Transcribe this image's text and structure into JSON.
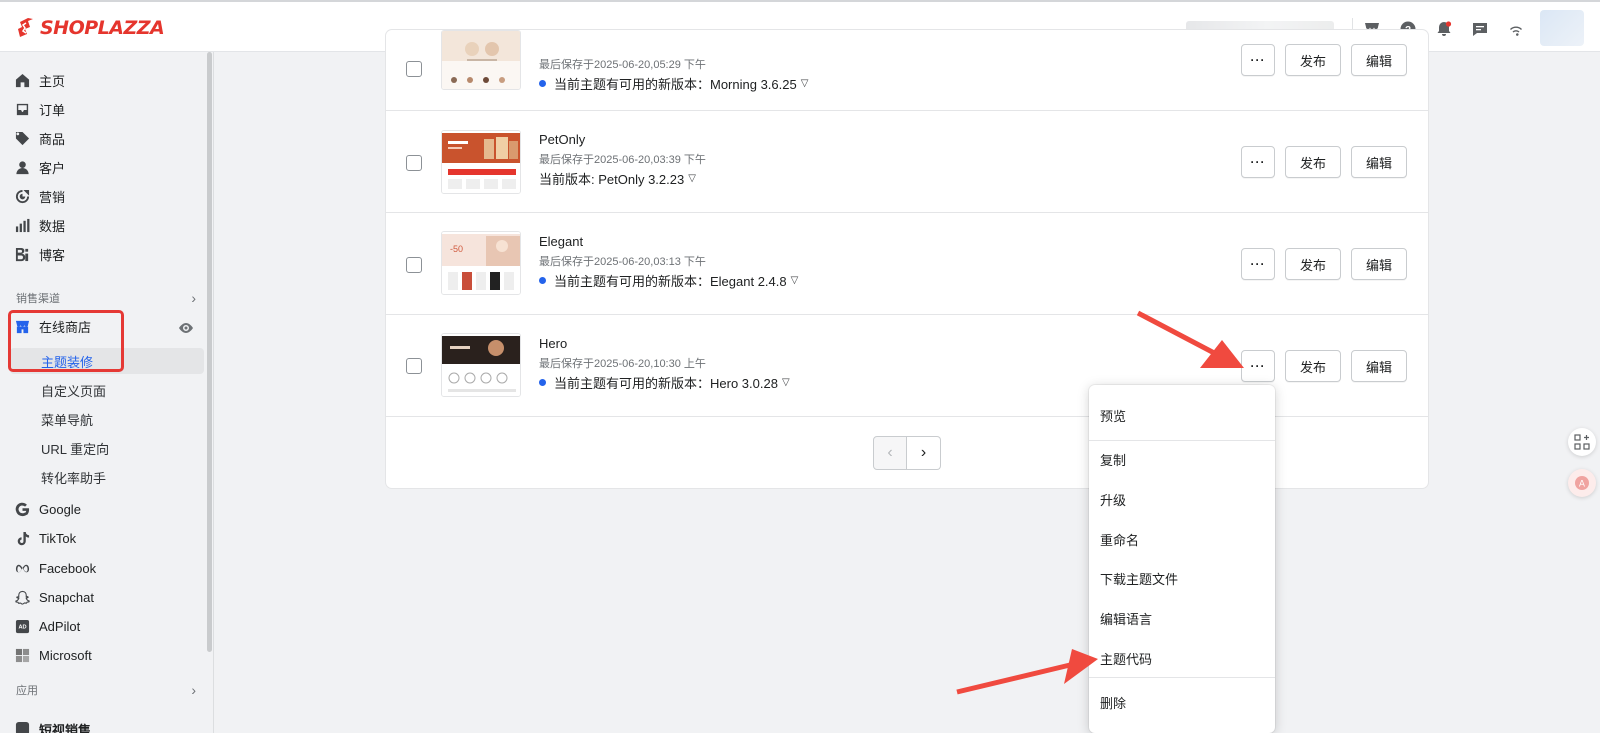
{
  "brand": {
    "logo_text": "SHOPLAZZA",
    "color": "#e5352d"
  },
  "topbar": {
    "icons": [
      "store-icon",
      "help-icon",
      "bell-icon",
      "chat-icon",
      "wifi-icon"
    ]
  },
  "sidebar": {
    "items": [
      {
        "label": "主页",
        "icon": "home-icon"
      },
      {
        "label": "订单",
        "icon": "inbox-icon"
      },
      {
        "label": "商品",
        "icon": "tag-icon"
      },
      {
        "label": "客户",
        "icon": "person-icon"
      },
      {
        "label": "营销",
        "icon": "target-icon"
      },
      {
        "label": "数据",
        "icon": "bars-icon"
      },
      {
        "label": "博客",
        "icon": "blog-icon"
      }
    ],
    "channels_heading": "销售渠道",
    "online_store": "在线商店",
    "sub_items": [
      "主题装修",
      "自定义页面",
      "菜单导航",
      "URL 重定向",
      "转化率助手"
    ],
    "channels": [
      {
        "label": "Google",
        "icon": "google-icon"
      },
      {
        "label": "TikTok",
        "icon": "tiktok-icon"
      },
      {
        "label": "Facebook",
        "icon": "meta-icon"
      },
      {
        "label": "Snapchat",
        "icon": "ghost-icon"
      },
      {
        "label": "AdPilot",
        "icon": "adpilot-icon"
      },
      {
        "label": "Microsoft",
        "icon": "windows-icon"
      }
    ],
    "apps_heading": "应用",
    "cut_item": "短视销售"
  },
  "themes": [
    {
      "name": "",
      "saved": "最后保存于2025-06-20,05:29 下午",
      "version": "当前主题有可用的新版本：Morning 3.6.25",
      "update": true
    },
    {
      "name": "PetOnly",
      "saved": "最后保存于2025-06-20,03:39 下午",
      "version": "当前版本: PetOnly 3.2.23",
      "update": false
    },
    {
      "name": "Elegant",
      "saved": "最后保存于2025-06-20,03:13 下午",
      "version": "当前主题有可用的新版本：Elegant 2.4.8",
      "update": true
    },
    {
      "name": "Hero",
      "saved": "最后保存于2025-06-20,10:30 上午",
      "version": "当前主题有可用的新版本：Hero 3.0.28",
      "update": true
    }
  ],
  "buttons": {
    "more": "···",
    "publish": "发布",
    "edit": "编辑"
  },
  "pager": {
    "prev": "‹",
    "next": "›"
  },
  "menu": {
    "items": [
      "预览",
      "复制",
      "升级",
      "重命名",
      "下载主题文件",
      "编辑语言",
      "主题代码",
      "删除"
    ]
  },
  "accent": "#2463eb",
  "annotation_color": "#e53935"
}
